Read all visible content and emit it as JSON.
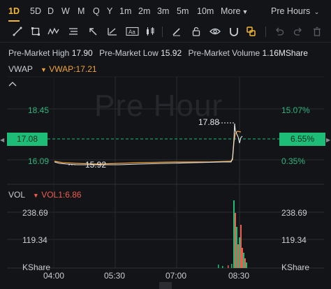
{
  "timeframes": [
    {
      "label": "1D",
      "active": true
    },
    {
      "label": "5D"
    },
    {
      "label": "D"
    },
    {
      "label": "W"
    },
    {
      "label": "M"
    },
    {
      "label": "Q"
    },
    {
      "label": "Y"
    },
    {
      "label": "1m"
    },
    {
      "label": "2m"
    },
    {
      "label": "3m"
    },
    {
      "label": "5m"
    },
    {
      "label": "10m"
    }
  ],
  "more_label": "More",
  "session_label": "Pre Hours",
  "toolbar_icons": [
    "line-tool-icon",
    "rectangle-tool-icon",
    "wave-tool-icon",
    "parallel-channel-icon",
    "arrow-tool-icon",
    "text-tool-icon",
    "measure-tool-icon",
    "pen-icon",
    "lock-icon",
    "eye-icon",
    "magnet-icon",
    "layers-icon",
    "undo-icon",
    "trash-icon"
  ],
  "stats": {
    "high_label": "Pre-Market High",
    "high": "17.90",
    "low_label": "Pre-Market Low",
    "low": "15.92",
    "volume_label": "Pre-Market Volume",
    "volume": "1.16MShare"
  },
  "vwap_panel": {
    "title": "VWAP",
    "indicator": "VWAP:17.21",
    "watermark": "Pre Hour",
    "left_axis": [
      "18.45",
      "16.09"
    ],
    "right_axis": [
      "15.07%",
      "0.35%"
    ],
    "current_price": "17.08",
    "current_pct": "6.55%",
    "high_marker": "17.88",
    "low_marker": "15.92",
    "colors": {
      "price": "#e8e8e8",
      "vwap": "#f0a33a",
      "up": "#1ebd77"
    }
  },
  "vol_panel": {
    "title": "VOL",
    "indicator": "VOL1:6.86",
    "left_axis": [
      "238.69",
      "119.34",
      "KShare"
    ],
    "right_axis": [
      "238.69",
      "119.34",
      "KShare"
    ]
  },
  "time_axis": [
    "04:00",
    "05:30",
    "07:00",
    "08:30"
  ]
}
